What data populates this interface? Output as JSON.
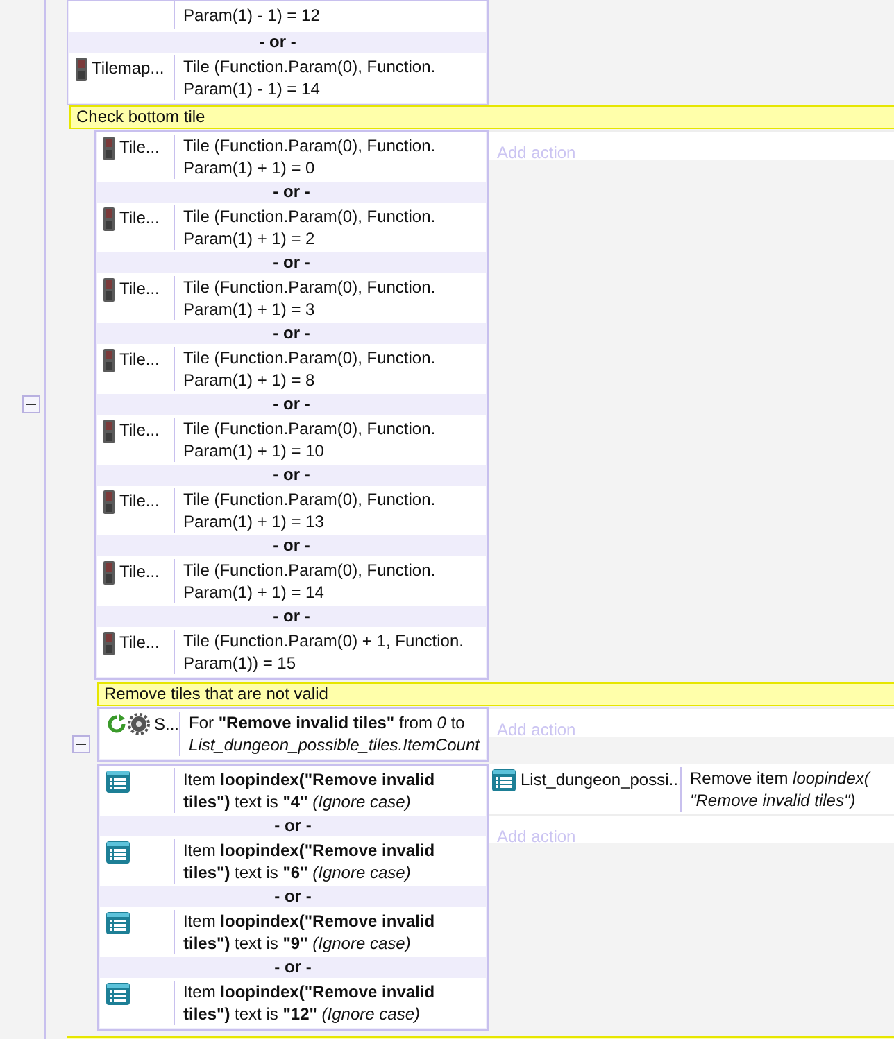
{
  "events": [
    {
      "kind": "event",
      "conditions": [
        {
          "kind": "clipped",
          "text": "Param(1) - 1) = 12"
        },
        {
          "kind": "tilemap",
          "object": "Tilemap...",
          "text": "Tile (Function.Param(0), Function. Param(1) - 1) = 14",
          "separator": "- or -"
        }
      ]
    },
    {
      "kind": "comment",
      "text": "Check bottom tile"
    },
    {
      "kind": "event",
      "expanded": true,
      "conditions": [
        {
          "kind": "tilemap",
          "object": "Tile...",
          "text": "Tile (Function.Param(0), Function. Param(1) + 1) = 0"
        },
        {
          "kind": "tilemap",
          "object": "Tile...",
          "text": "Tile (Function.Param(0), Function. Param(1) + 1) = 2",
          "separator": "- or -"
        },
        {
          "kind": "tilemap",
          "object": "Tile...",
          "text": "Tile (Function.Param(0), Function. Param(1) + 1) = 3",
          "separator": "- or -"
        },
        {
          "kind": "tilemap",
          "object": "Tile...",
          "text": "Tile (Function.Param(0), Function. Param(1) + 1) = 8",
          "separator": "- or -"
        },
        {
          "kind": "tilemap",
          "object": "Tile...",
          "text": "Tile (Function.Param(0), Function. Param(1) + 1) = 10",
          "separator": "- or -"
        },
        {
          "kind": "tilemap",
          "object": "Tile...",
          "text": "Tile (Function.Param(0), Function. Param(1) + 1) = 13",
          "separator": "- or -"
        },
        {
          "kind": "tilemap",
          "object": "Tile...",
          "text": "Tile (Function.Param(0), Function. Param(1) + 1) = 14",
          "separator": "- or -"
        },
        {
          "kind": "tilemap",
          "object": "Tile...",
          "text": "Tile (Function.Param(0) + 1, Function. Param(1)) = 15",
          "separator": "- or -"
        }
      ],
      "add_action": "Add action",
      "children": [
        {
          "kind": "comment",
          "text": "Remove tiles that are not valid"
        },
        {
          "kind": "event",
          "expanded": true,
          "conditions": [
            {
              "kind": "system",
              "object": "S...",
              "text": "For **\"Remove invalid tiles\"** from *0* to *List_dungeon_possible_tiles.ItemCount*"
            }
          ],
          "add_action": "Add action",
          "children": [
            {
              "kind": "event",
              "conditions": [
                {
                  "kind": "list",
                  "text": "Item **loopindex(\"Remove invalid tiles\")** text is **\"4\"** *(Ignore case)*"
                },
                {
                  "kind": "list",
                  "text": "Item **loopindex(\"Remove invalid tiles\")** text is **\"6\"** *(Ignore case)*",
                  "separator": "- or -"
                },
                {
                  "kind": "list",
                  "text": "Item **loopindex(\"Remove invalid tiles\")** text is **\"9\"** *(Ignore case)*",
                  "separator": "- or -"
                },
                {
                  "kind": "list",
                  "text": "Item **loopindex(\"Remove invalid tiles\")** text is **\"12\"** *(Ignore case)*",
                  "separator": "- or -"
                }
              ],
              "actions": [
                {
                  "kind": "list",
                  "object": "List_dungeon_possi...",
                  "text": "Remove item *loopindex( \"Remove invalid tiles\")*"
                }
              ],
              "add_action": "Add action"
            }
          ]
        }
      ]
    }
  ]
}
